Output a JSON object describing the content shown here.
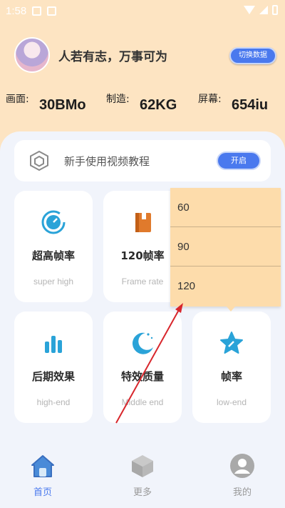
{
  "status": {
    "time": "1:58"
  },
  "header": {
    "motto": "人若有志，万事可为",
    "switch_label": "切换数据"
  },
  "stats": [
    {
      "label": "画面:",
      "value": "30BMo"
    },
    {
      "label": "制造:",
      "value": "62KG"
    },
    {
      "label": "屏幕:",
      "value": "654iu"
    }
  ],
  "tutorial": {
    "text": "新手使用视频教程",
    "button": "开启"
  },
  "cards": [
    {
      "title": "超高帧率",
      "sub": "super high",
      "icon": "speedometer-icon"
    },
    {
      "title": "120帧率",
      "sub": "Frame rate",
      "icon": "book-icon"
    },
    {
      "title": "后期效果",
      "sub": "high-end",
      "icon": "bar-chart-icon"
    },
    {
      "title": "特效质量",
      "sub": "Middle end",
      "icon": "moon-icon"
    },
    {
      "title": "帧率",
      "sub": "low-end",
      "icon": "star-icon"
    }
  ],
  "dropdown": {
    "options": [
      "60",
      "90",
      "120"
    ]
  },
  "nav": [
    {
      "label": "首页",
      "icon": "home-icon",
      "active": true
    },
    {
      "label": "更多",
      "icon": "cube-icon",
      "active": false
    },
    {
      "label": "我的",
      "icon": "user-icon",
      "active": false
    }
  ],
  "colors": {
    "accent": "#4a79ee",
    "header_bg": "#fde4c2",
    "panel_bg": "#f1f4fb",
    "dropdown_bg": "#fddcab",
    "icon_blue": "#2aa3d8",
    "icon_orange": "#e07a2c",
    "arrow_red": "#d8262c"
  }
}
